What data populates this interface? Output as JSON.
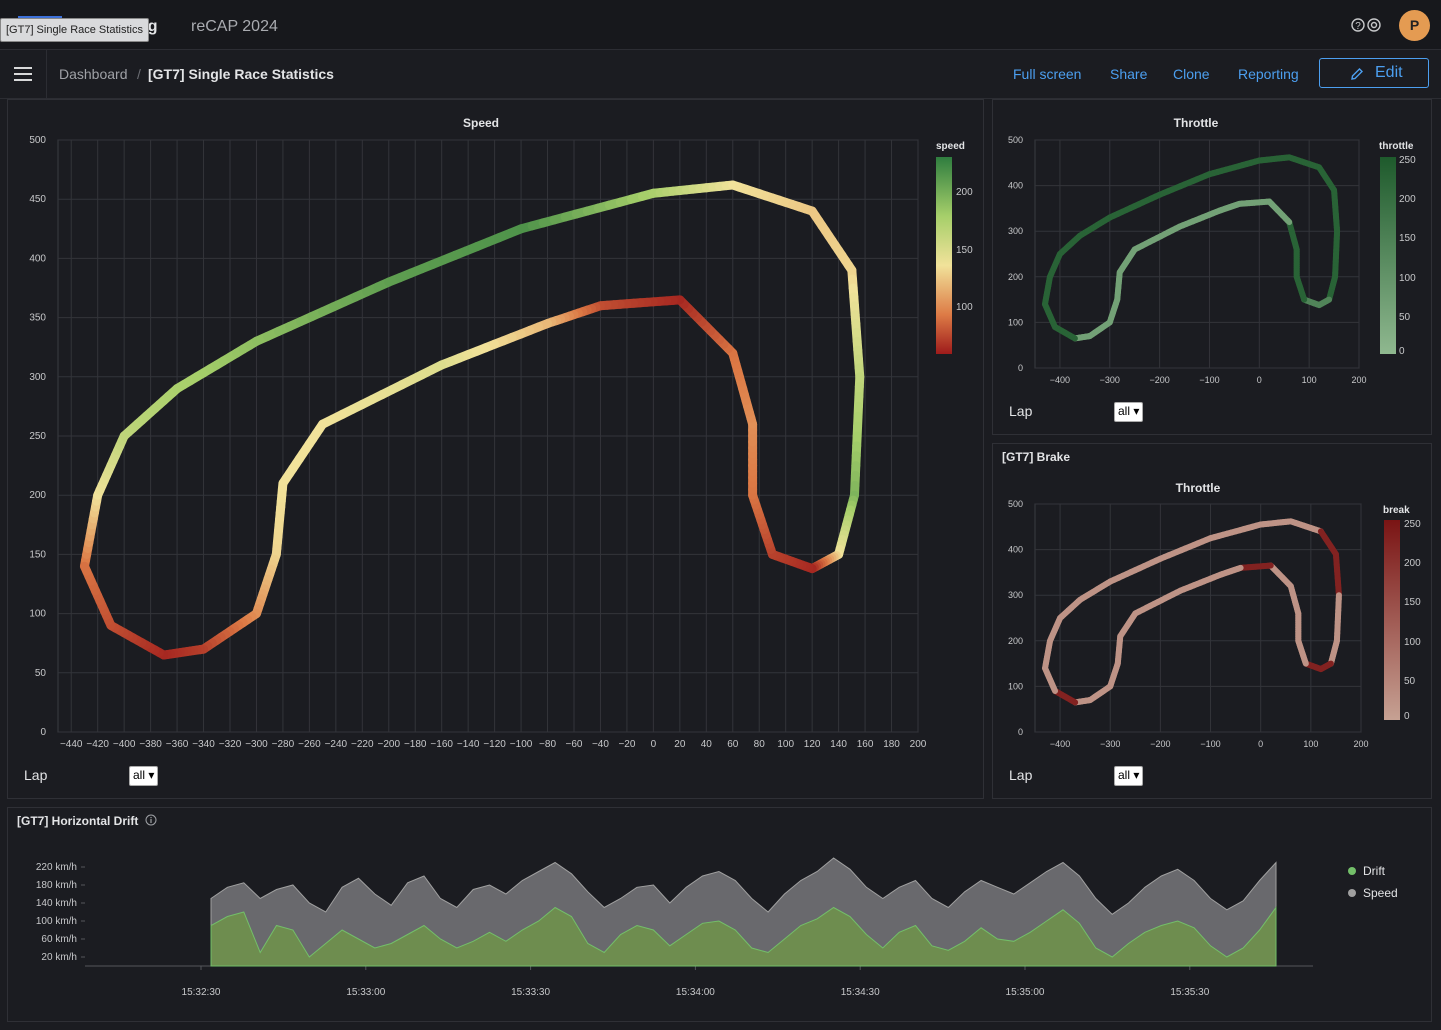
{
  "topbar": {
    "title_fragment": "ng",
    "subtitle": "reCAP 2024",
    "tooltip": "[GT7] Single Race Statistics",
    "avatar_initial": "P"
  },
  "navbar": {
    "breadcrumb_root": "Dashboard",
    "breadcrumb_sep": "/",
    "page_title": "[GT7] Single Race Statistics",
    "links": [
      "Full screen",
      "Share",
      "Clone",
      "Reporting"
    ],
    "edit_label": "Edit",
    "accent": "#4c9ff0"
  },
  "speed_panel": {
    "plot_title": "Speed",
    "colorbar_title": "speed",
    "colorbar_ticks": [
      "200",
      "150",
      "100"
    ],
    "colorscale": [
      "#2f7d3f",
      "#a6cf6a",
      "#f1e29a",
      "#dd7b46",
      "#9e1b1b"
    ],
    "lap_label": "Lap",
    "lap_value": "all"
  },
  "throttle_panel": {
    "plot_title": "Throttle",
    "colorbar_title": "throttle",
    "colorbar_ticks": [
      "250",
      "200",
      "150",
      "100",
      "50",
      "0"
    ],
    "colorscale": [
      "#1e5a2c",
      "#8fb88f"
    ],
    "lap_label": "Lap",
    "lap_value": "all"
  },
  "brake_panel": {
    "panel_title": "[GT7] Brake",
    "plot_title": "Throttle",
    "colorbar_title": "break",
    "colorbar_ticks": [
      "250",
      "200",
      "150",
      "100",
      "50",
      "0"
    ],
    "colorscale": [
      "#7a1414",
      "#c6a193"
    ],
    "lap_label": "Lap",
    "lap_value": "all"
  },
  "drift_panel": {
    "panel_title": "[GT7] Horizontal Drift",
    "legend": [
      {
        "name": "Drift",
        "color": "#73bf69"
      },
      {
        "name": "Speed",
        "color": "#a0a0a0"
      }
    ]
  },
  "chart_data": [
    {
      "type": "scatter",
      "title": "Speed",
      "colorbar": "speed",
      "x_ticks": [
        "−440",
        "−420",
        "−400",
        "−380",
        "−360",
        "−340",
        "−320",
        "−300",
        "−280",
        "−260",
        "−240",
        "−220",
        "−200",
        "−180",
        "−160",
        "−140",
        "−120",
        "−100",
        "−80",
        "−60",
        "−40",
        "−20",
        "0",
        "20",
        "40",
        "60",
        "80",
        "100",
        "120",
        "140",
        "160",
        "180",
        "200"
      ],
      "y_ticks": [
        "500",
        "450",
        "400",
        "350",
        "300",
        "250",
        "200",
        "150",
        "100",
        "50",
        "0"
      ],
      "xlim": [
        -450,
        200
      ],
      "ylim": [
        0,
        500
      ],
      "grid": true,
      "track": [
        {
          "x": -430,
          "y": 140,
          "v": 110
        },
        {
          "x": -420,
          "y": 200,
          "v": 150
        },
        {
          "x": -400,
          "y": 250,
          "v": 175
        },
        {
          "x": -360,
          "y": 290,
          "v": 185
        },
        {
          "x": -300,
          "y": 330,
          "v": 195
        },
        {
          "x": -200,
          "y": 380,
          "v": 210
        },
        {
          "x": -100,
          "y": 425,
          "v": 215
        },
        {
          "x": 0,
          "y": 455,
          "v": 185
        },
        {
          "x": 60,
          "y": 462,
          "v": 150
        },
        {
          "x": 120,
          "y": 440,
          "v": 140
        },
        {
          "x": 150,
          "y": 390,
          "v": 145
        },
        {
          "x": 156,
          "y": 300,
          "v": 175
        },
        {
          "x": 152,
          "y": 200,
          "v": 200
        },
        {
          "x": 140,
          "y": 150,
          "v": 150
        },
        {
          "x": 120,
          "y": 138,
          "v": 80
        },
        {
          "x": 90,
          "y": 150,
          "v": 90
        },
        {
          "x": 75,
          "y": 200,
          "v": 110
        },
        {
          "x": 75,
          "y": 260,
          "v": 120
        },
        {
          "x": 60,
          "y": 320,
          "v": 110
        },
        {
          "x": 20,
          "y": 365,
          "v": 80
        },
        {
          "x": -40,
          "y": 360,
          "v": 95
        },
        {
          "x": -80,
          "y": 345,
          "v": 135
        },
        {
          "x": -160,
          "y": 310,
          "v": 160
        },
        {
          "x": -250,
          "y": 260,
          "v": 150
        },
        {
          "x": -280,
          "y": 210,
          "v": 150
        },
        {
          "x": -285,
          "y": 150,
          "v": 145
        },
        {
          "x": -300,
          "y": 100,
          "v": 120
        },
        {
          "x": -340,
          "y": 70,
          "v": 90
        },
        {
          "x": -370,
          "y": 65,
          "v": 80
        },
        {
          "x": -410,
          "y": 90,
          "v": 95
        },
        {
          "x": -430,
          "y": 140,
          "v": 110
        }
      ]
    },
    {
      "type": "scatter",
      "title": "Throttle",
      "colorbar": "throttle",
      "x_ticks": [
        "−400",
        "−300",
        "−200",
        "−100",
        "0",
        "100",
        "200"
      ],
      "y_ticks": [
        "500",
        "400",
        "300",
        "200",
        "100",
        "0"
      ],
      "xlim": [
        -450,
        200
      ],
      "ylim": [
        0,
        500
      ],
      "grid": true
    },
    {
      "type": "scatter",
      "title": "Throttle",
      "colorbar": "break",
      "x_ticks": [
        "−400",
        "−300",
        "−200",
        "−100",
        "0",
        "100",
        "200"
      ],
      "y_ticks": [
        "500",
        "400",
        "300",
        "200",
        "100",
        "0"
      ],
      "xlim": [
        -450,
        200
      ],
      "ylim": [
        0,
        500
      ],
      "grid": true
    },
    {
      "type": "area",
      "title": "[GT7] Horizontal Drift",
      "y_ticks": [
        "220 km/h",
        "180 km/h",
        "140 km/h",
        "100 km/h",
        "60 km/h",
        "20 km/h"
      ],
      "x_ticks": [
        "15:32:30",
        "15:33:00",
        "15:33:30",
        "15:34:00",
        "15:34:30",
        "15:35:00",
        "15:35:30"
      ],
      "ylim": [
        0,
        240
      ],
      "series": [
        {
          "name": "Speed",
          "color": "#a0a0a0",
          "values": [
            150,
            175,
            185,
            150,
            170,
            180,
            140,
            120,
            175,
            195,
            160,
            135,
            185,
            200,
            150,
            130,
            170,
            180,
            160,
            190,
            210,
            230,
            205,
            165,
            130,
            150,
            175,
            180,
            140,
            175,
            200,
            210,
            190,
            150,
            120,
            160,
            190,
            210,
            240,
            215,
            175,
            150,
            175,
            190,
            150,
            130,
            165,
            190,
            175,
            160,
            185,
            210,
            230,
            200,
            150,
            115,
            140,
            175,
            200,
            215,
            190,
            150,
            125,
            145,
            190,
            230
          ]
        },
        {
          "name": "Drift",
          "color": "#73bf69",
          "values": [
            90,
            110,
            120,
            30,
            90,
            80,
            20,
            50,
            80,
            60,
            40,
            50,
            70,
            90,
            60,
            40,
            55,
            75,
            55,
            80,
            100,
            130,
            110,
            50,
            30,
            70,
            90,
            80,
            45,
            70,
            95,
            100,
            80,
            40,
            30,
            60,
            90,
            105,
            130,
            110,
            70,
            40,
            75,
            90,
            45,
            35,
            55,
            85,
            60,
            55,
            75,
            100,
            125,
            95,
            40,
            20,
            50,
            75,
            90,
            100,
            85,
            45,
            20,
            40,
            80,
            130
          ]
        }
      ]
    }
  ]
}
